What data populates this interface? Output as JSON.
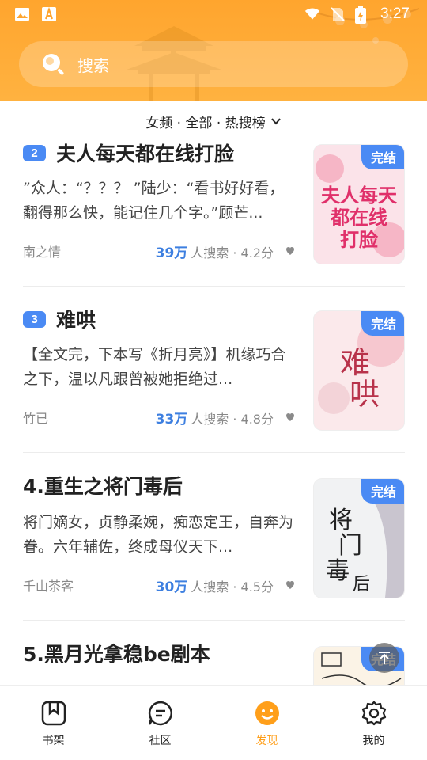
{
  "status_bar": {
    "time": "3:27",
    "icons": [
      "image-icon",
      "a-icon",
      "wifi-icon",
      "no-sim-icon",
      "battery-charging-icon"
    ]
  },
  "search": {
    "placeholder": "搜索"
  },
  "filter": {
    "label": "女频 · 全部 · 热搜榜"
  },
  "books": [
    {
      "rank": "2",
      "title": "夫人每天都在线打脸",
      "desc": "”众人：“？？？ ”陆少：“看书好好看，翻得那么快，能记住几个字。”顾芒...",
      "author": "南之情",
      "count": "39万",
      "suffix": "人搜索 · 4.2分",
      "badge": "完结",
      "cover_text": "夫人每天都在线打脸",
      "cover_color": "#f7c9d3"
    },
    {
      "rank": "3",
      "title": "难哄",
      "desc": "【全文完，下本写《折月亮》】机缘巧合之下，温以凡跟曾被她拒绝过...",
      "author": "竹已",
      "count": "33万",
      "suffix": "人搜索 · 4.8分",
      "badge": "完结",
      "cover_text": "难哄",
      "cover_color": "#f9dfe2"
    },
    {
      "rank": "",
      "title": "4.重生之将门毒后",
      "desc": "将门嫡女，贞静柔婉，痴恋定王，自奔为眷。六年辅佐，终成母仪天下...",
      "author": "千山茶客",
      "count": "30万",
      "suffix": "人搜索 · 4.5分",
      "badge": "完结",
      "cover_text": "将门毒后",
      "cover_color": "#eef0f2"
    },
    {
      "rank": "",
      "title": "5.黑月光拿稳be剧本",
      "desc": "",
      "author": "",
      "count": "",
      "suffix": "",
      "badge": "完结",
      "cover_text": "",
      "cover_color": "#fbf3e6"
    }
  ],
  "bottom_nav": [
    {
      "label": "书架",
      "icon": "bookshelf-icon"
    },
    {
      "label": "社区",
      "icon": "community-icon"
    },
    {
      "label": "发现",
      "icon": "discover-smile-icon",
      "active": true
    },
    {
      "label": "我的",
      "icon": "settings-gear-icon"
    }
  ],
  "colors": {
    "header": "#ffa52e",
    "accent": "#4a8af4",
    "count_blue": "#3d7fe0",
    "active_nav": "#ff9f1a"
  }
}
